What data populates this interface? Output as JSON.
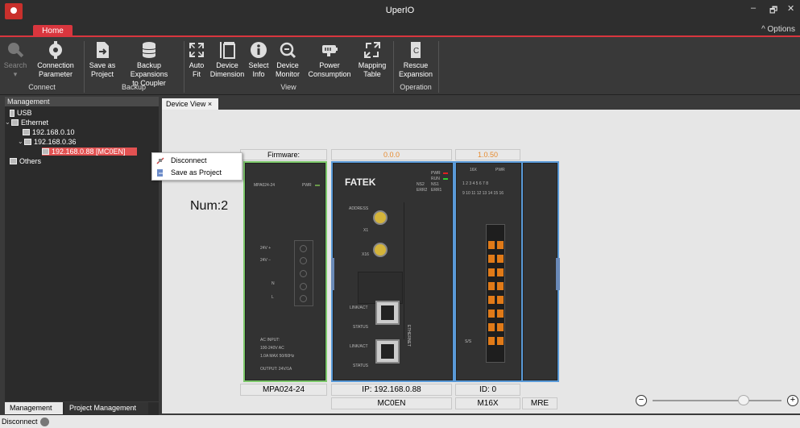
{
  "window": {
    "title": "UperIO",
    "minimize": "–",
    "restore": "🗗",
    "close": "✕"
  },
  "ribbon_tabs": {
    "home": "Home",
    "options": "^  Options"
  },
  "ribbon": {
    "search": {
      "label": "Search",
      "arrow": "▾"
    },
    "connection_parameter": {
      "label1": "Connection",
      "label2": "Parameter"
    },
    "save_as_project": {
      "label1": "Save as",
      "label2": "Project"
    },
    "backup_expansions": {
      "label1": "Backup Expansions",
      "label2": "to Coupler"
    },
    "auto_fit": {
      "label1": "Auto",
      "label2": "Fit"
    },
    "device_dimension": {
      "label1": "Device",
      "label2": "Dimension"
    },
    "select_info": {
      "label1": "Select",
      "label2": "Info"
    },
    "device_monitor": {
      "label1": "Device",
      "label2": "Monitor"
    },
    "power_consumption": {
      "label1": "Power",
      "label2": "Consumption"
    },
    "mapping_table": {
      "label1": "Mapping",
      "label2": "Table"
    },
    "rescue_expansion": {
      "label1": "Rescue",
      "label2": "Expansion"
    },
    "groups": {
      "connect": "Connect",
      "backup": "Backup",
      "view": "View",
      "operation": "Operation"
    }
  },
  "left_panel": {
    "header": "Management",
    "tree": [
      {
        "label": "USB"
      },
      {
        "label": "Ethernet"
      },
      {
        "label": "192.168.0.10"
      },
      {
        "label": "192.168.0.36"
      },
      {
        "label": "192.168.0.88 [MC0EN]"
      },
      {
        "label": "Others"
      }
    ],
    "tabs": {
      "management": "Management",
      "project_management": "Project Management"
    }
  },
  "context_menu": {
    "disconnect": "Disconnect",
    "save_as_project": "Save as Project"
  },
  "document": {
    "tab_label": "Device View ×"
  },
  "device_view": {
    "num": "Num:2",
    "firmware_label": "Firmware:",
    "firmware_coupler": "0.0.0",
    "firmware_m16x": "1.0.50",
    "power_model": "MPA024-24",
    "ip": "IP: 192.168.0.88",
    "id": "ID:  0",
    "coupler_name": "MC0EN",
    "m16x_name": "M16X",
    "mre_name": "MRE",
    "fatek": "FATEK",
    "psu": {
      "model": "MPA024-24",
      "pwr": "PWR",
      "v_plus": "24V +",
      "v_minus": "24V −",
      "n": "N",
      "l": "L",
      "ac_input": "AC INPUT:",
      "ac_v": "100-240V AC",
      "ac_a": "1.0A MAX 50/60Hz",
      "output": "OUTPUT: 24V/1A"
    },
    "coupler": {
      "pwr": "PWR",
      "run": "RUN",
      "ns1": "NS1",
      "ns2": "NS2",
      "err1": "ERR1",
      "err2": "ERR2",
      "address": "ADDRESS",
      "x1": "X1",
      "x16": "X16",
      "link1": "LINK/ACT",
      "status1": "STATUS",
      "link2": "LINK/ACT",
      "status2": "STATUS",
      "ethercat": "ETHERNET"
    },
    "m16x": {
      "model": "16X",
      "pwr": "PWR",
      "row1": "1  2  3  4  5  6  7  8",
      "row2": "9 10 11 12 13 14 15 16",
      "ss": "S/S"
    }
  },
  "status_bar": {
    "text": "Disconnect"
  },
  "colors": {
    "accent": "#d9363e",
    "orange_text": "#e68a2e",
    "green_selection": "#7cc86a",
    "blue_selection": "#5a9ad8"
  }
}
